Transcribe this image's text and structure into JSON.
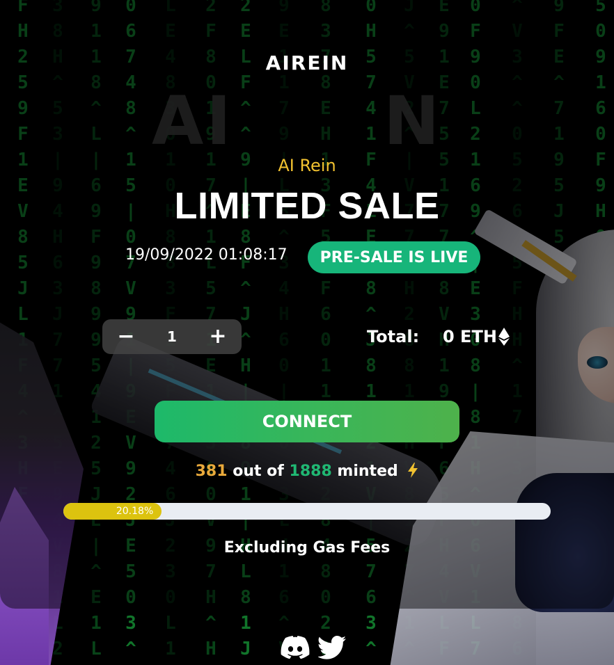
{
  "brand": {
    "logo_text": "AIREIN",
    "bg_logo_left": "AI",
    "bg_logo_right": "N"
  },
  "sale": {
    "subtitle": "AI Rein",
    "title": "LIMITED SALE",
    "datetime": "19/09/2022 01:08:17",
    "status_badge": "PRE-SALE IS LIVE"
  },
  "purchase": {
    "decrement_label": "−",
    "quantity": "1",
    "increment_label": "+",
    "total_label": "Total:",
    "total_value": "0 ETH"
  },
  "connect_label": "CONNECT",
  "mint": {
    "minted": "381",
    "out_of": "out of",
    "supply": "1888",
    "suffix": "minted",
    "progress_label": "20.18%",
    "progress_fraction": 0.2018
  },
  "gas_note": "Excluding Gas Fees",
  "socials": [
    {
      "name": "discord-icon"
    },
    {
      "name": "twitter-icon"
    }
  ],
  "colors": {
    "accent_yellow": "#f2c230",
    "badge_green": "#17b57a",
    "minted_orange": "#e9a93b",
    "supply_green": "#20b873",
    "progress_fill": "#dcc30f",
    "progress_track": "#e9edf3"
  }
}
